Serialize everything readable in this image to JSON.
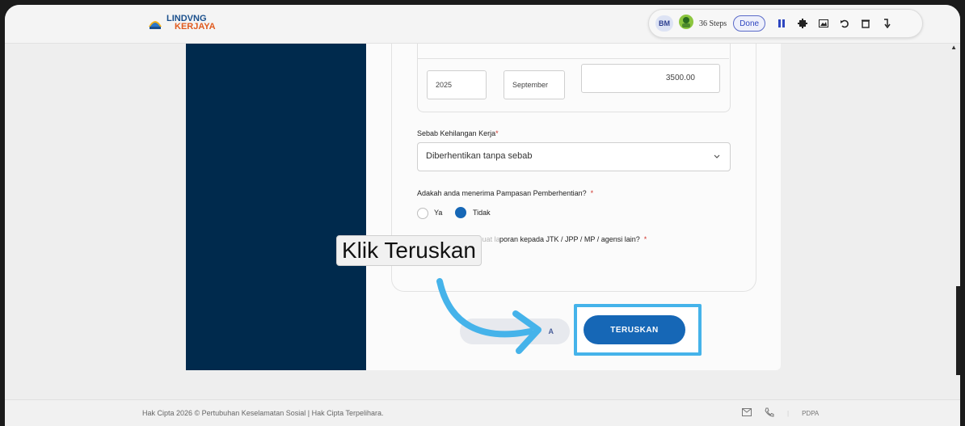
{
  "header": {
    "logo_line1": "LINDVNG",
    "logo_line2": "KERJAYA"
  },
  "toolbar": {
    "badge": "BM",
    "steps": "36 Steps",
    "done": "Done",
    "icons": [
      "pause-icon",
      "stop-icon",
      "image-icon",
      "undo-icon",
      "trash-icon",
      "download-icon"
    ]
  },
  "form": {
    "year_value": "2025",
    "month_value": "September",
    "amount_value": "3500.00",
    "reason_label": "Sebab Kehilangan Kerja",
    "reason_value": "Diberhentikan tanpa sebab",
    "compensation_question": "Adakah anda menerima Pampasan Pemberhentian?",
    "option_yes": "Ya",
    "option_no": "Tidak",
    "selected_option": "Tidak",
    "report_question_part1": "Adakah anda membuat la",
    "report_question_part2": "poran kepada JTK / JPP / MP / agensi lain?",
    "required_mark": "*"
  },
  "buttons": {
    "back_fragment_left": "",
    "back_fragment_right": "A",
    "next": "TERUSKAN"
  },
  "callout": {
    "text": "Klik Teruskan"
  },
  "footer": {
    "copyright": "Hak Cipta 2026 © Pertubuhan Keselamatan Sosial | Hak Cipta Terpelihara.",
    "pdpa": "PDPA"
  },
  "colors": {
    "panel": "#002a4d",
    "primary": "#1667b6",
    "highlight": "#45b3ea",
    "required": "#d0342c"
  }
}
